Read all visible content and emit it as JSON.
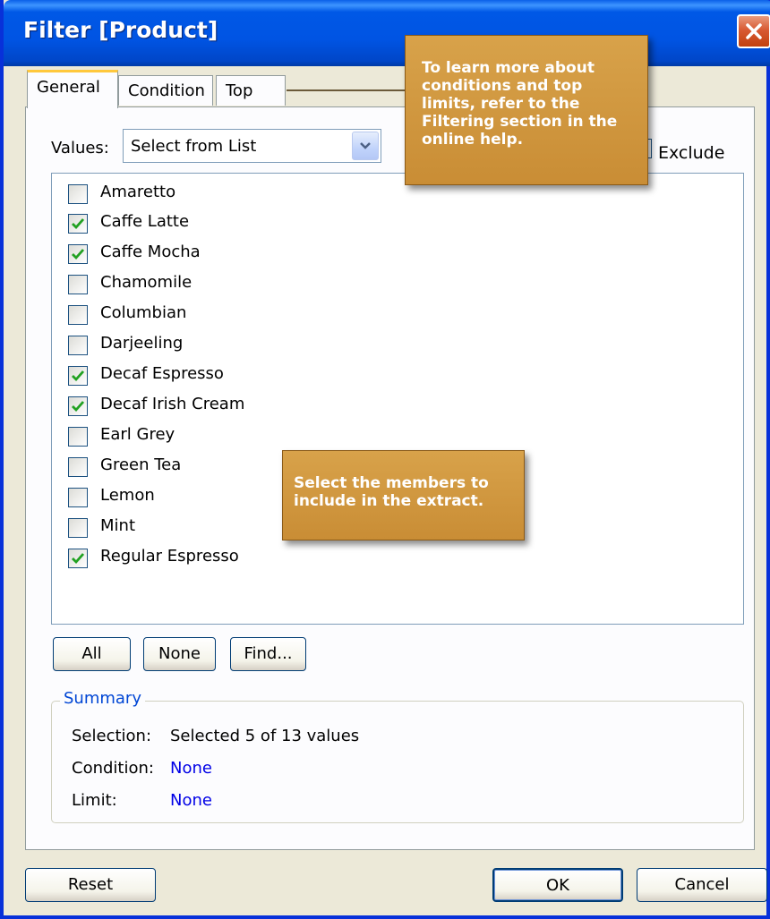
{
  "window": {
    "title": "Filter [Product]"
  },
  "tabs": [
    {
      "label": "General",
      "active": true
    },
    {
      "label": "Condition",
      "active": false
    },
    {
      "label": "Top",
      "active": false
    }
  ],
  "values": {
    "label": "Values:",
    "selected": "Select from List"
  },
  "exclude": {
    "label": "Exclude",
    "checked": false
  },
  "members": [
    {
      "label": "Amaretto",
      "checked": false
    },
    {
      "label": "Caffe Latte",
      "checked": true
    },
    {
      "label": "Caffe Mocha",
      "checked": true
    },
    {
      "label": "Chamomile",
      "checked": false
    },
    {
      "label": "Columbian",
      "checked": false
    },
    {
      "label": "Darjeeling",
      "checked": false
    },
    {
      "label": "Decaf Espresso",
      "checked": true
    },
    {
      "label": "Decaf Irish Cream",
      "checked": true
    },
    {
      "label": "Earl Grey",
      "checked": false
    },
    {
      "label": "Green Tea",
      "checked": false
    },
    {
      "label": "Lemon",
      "checked": false
    },
    {
      "label": "Mint",
      "checked": false
    },
    {
      "label": "Regular Espresso",
      "checked": true
    }
  ],
  "list_buttons": {
    "all": "All",
    "none": "None",
    "find": "Find..."
  },
  "summary": {
    "legend": "Summary",
    "selection_label": "Selection:",
    "selection_value": "Selected 5 of 13 values",
    "condition_label": "Condition:",
    "condition_value": "None",
    "limit_label": "Limit:",
    "limit_value": "None"
  },
  "footer": {
    "reset": "Reset",
    "ok": "OK",
    "cancel": "Cancel"
  },
  "callouts": {
    "top": "To learn more about conditions and top limits, refer to the Filtering section in the online help.",
    "middle": "Select the members to include in the extract."
  },
  "colors": {
    "title_bar": "#0054e3",
    "callout": "#c98d35",
    "link_blue": "#0000e6",
    "check_green": "#21a121"
  }
}
